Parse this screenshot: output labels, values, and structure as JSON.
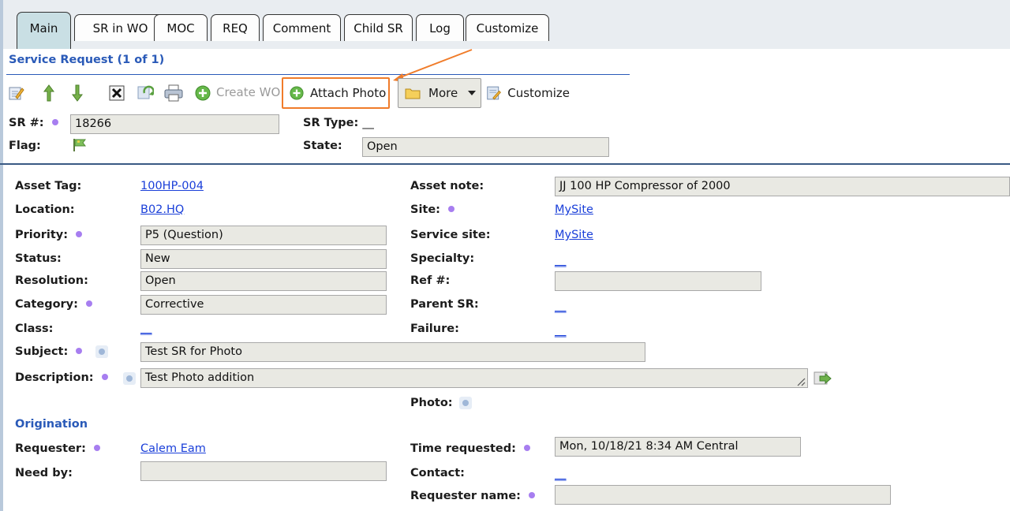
{
  "tabs": [
    "Main",
    "SR in WO",
    "MOC",
    "REQ",
    "Comment",
    "Child SR",
    "Log",
    "Customize"
  ],
  "section_title": "Service Request (1 of 1)",
  "toolbar": {
    "create_wo": "Create WO",
    "attach_photo": "Attach Photo",
    "more": "More",
    "customize": "Customize",
    "icons": [
      "edit-icon",
      "arrow-up-icon",
      "arrow-down-icon",
      "delete-icon",
      "refresh-icon",
      "print-icon",
      "add-circle-icon",
      "folder-icon",
      "dropdown-arrow-icon",
      "customize-icon"
    ]
  },
  "header": {
    "sr_label": "SR #:",
    "sr_value": "18266",
    "flag_label": "Flag:",
    "srtype_label": "SR Type:",
    "srtype_value": "__",
    "state_label": "State:",
    "state_value": "Open"
  },
  "form": {
    "asset_tag_label": "Asset Tag:",
    "asset_tag_value": "100HP-004",
    "location_label": "Location:",
    "location_value": "B02.HQ",
    "priority_label": "Priority:",
    "priority_value": "P5 (Question)",
    "status_label": "Status:",
    "status_value": "New",
    "resolution_label": "Resolution:",
    "resolution_value": "Open",
    "category_label": "Category:",
    "category_value": "Corrective",
    "class_label": "Class:",
    "class_value": "__",
    "subject_label": "Subject:",
    "subject_value": "Test SR for Photo",
    "description_label": "Description:",
    "description_value": "Test Photo addition",
    "asset_note_label": "Asset note:",
    "asset_note_value": "JJ 100 HP Compressor of 2000",
    "site_label": "Site:",
    "site_value": "MySite",
    "service_site_label": "Service site:",
    "service_site_value": "MySite",
    "specialty_label": "Specialty:",
    "specialty_value": "__",
    "ref_label": "Ref #:",
    "ref_value": "",
    "parent_sr_label": "Parent SR:",
    "parent_sr_value": "__",
    "failure_label": "Failure:",
    "failure_value": "__",
    "photo_label": "Photo:"
  },
  "origination": {
    "title": "Origination",
    "requester_label": "Requester:",
    "requester_value": "Calem Eam",
    "need_by_label": "Need by:",
    "need_by_value": "",
    "time_requested_label": "Time requested:",
    "time_requested_value": "Mon, 10/18/21 8:34 AM Central",
    "contact_label": "Contact:",
    "contact_value": "__",
    "requester_name_label": "Requester name:",
    "requester_name_value": ""
  },
  "colors": {
    "accent": "#2a5ab8",
    "active_tab": "#c9dfe4",
    "highlight_annotation": "#f07c2a",
    "required_dot": "#a77ef0",
    "link": "#1a3fd9"
  }
}
